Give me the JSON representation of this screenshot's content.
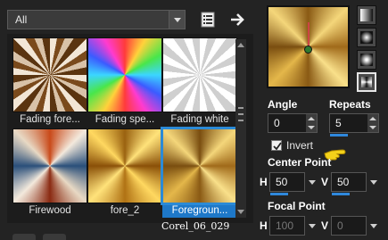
{
  "filter": {
    "selected": "All"
  },
  "toolbar": {
    "doc_icon": "document-list-icon",
    "arrow_icon": "arrow-right-icon"
  },
  "gallery": {
    "items": [
      {
        "label": "Fading fore...",
        "pattern": "fading-foreground"
      },
      {
        "label": "Fading spe...",
        "pattern": "fading-spectrum"
      },
      {
        "label": "Fading white",
        "pattern": "fading-white"
      },
      {
        "label": "Firewood",
        "pattern": "firewood"
      },
      {
        "label": "fore_2",
        "pattern": "fore-2"
      },
      {
        "label": "Foregroun...",
        "pattern": "foreground",
        "selected": true
      }
    ]
  },
  "watermark": "Corel_06_029",
  "settings": {
    "angle_label": "Angle",
    "angle_value": "0",
    "repeats_label": "Repeats",
    "repeats_value": "5",
    "invert_label": "Invert",
    "invert_checked": true,
    "center_point_label": "Center Point",
    "center_h_label": "H",
    "center_h_value": "50",
    "center_v_label": "V",
    "center_v_value": "50",
    "focal_point_label": "Focal Point",
    "focal_h_label": "H",
    "focal_h_value": "100",
    "focal_v_label": "V",
    "focal_v_value": "0"
  },
  "colors": {
    "accent": "#1e78c8",
    "slider": "#2f88dc",
    "gold": "#e4b74a"
  }
}
